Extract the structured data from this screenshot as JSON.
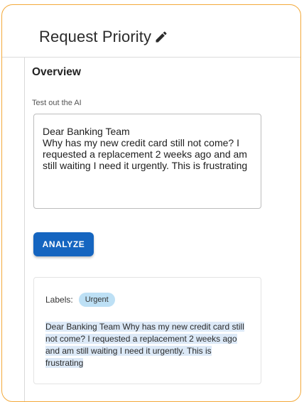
{
  "header": {
    "title": "Request Priority",
    "edit_icon": "pencil-icon"
  },
  "overview": {
    "heading": "Overview",
    "input_label": "Test out the AI",
    "input_value": "Dear Banking Team\nWhy has my new credit card still not come? I requested a replacement 2 weeks ago and am still waiting I need it urgently. This is frustrating",
    "analyze_label": "ANALYZE"
  },
  "result": {
    "labels_caption": "Labels:",
    "label_badge": "Urgent",
    "text": "Dear Banking Team Why has my new credit card still not come? I requested a replacement 2 weeks ago and am still waiting I need it urgently. This is frustrating"
  },
  "colors": {
    "frame_border": "#f3a93a",
    "button": "#1565c0",
    "badge": "#bde0f5",
    "highlight": "#dce9f7"
  }
}
